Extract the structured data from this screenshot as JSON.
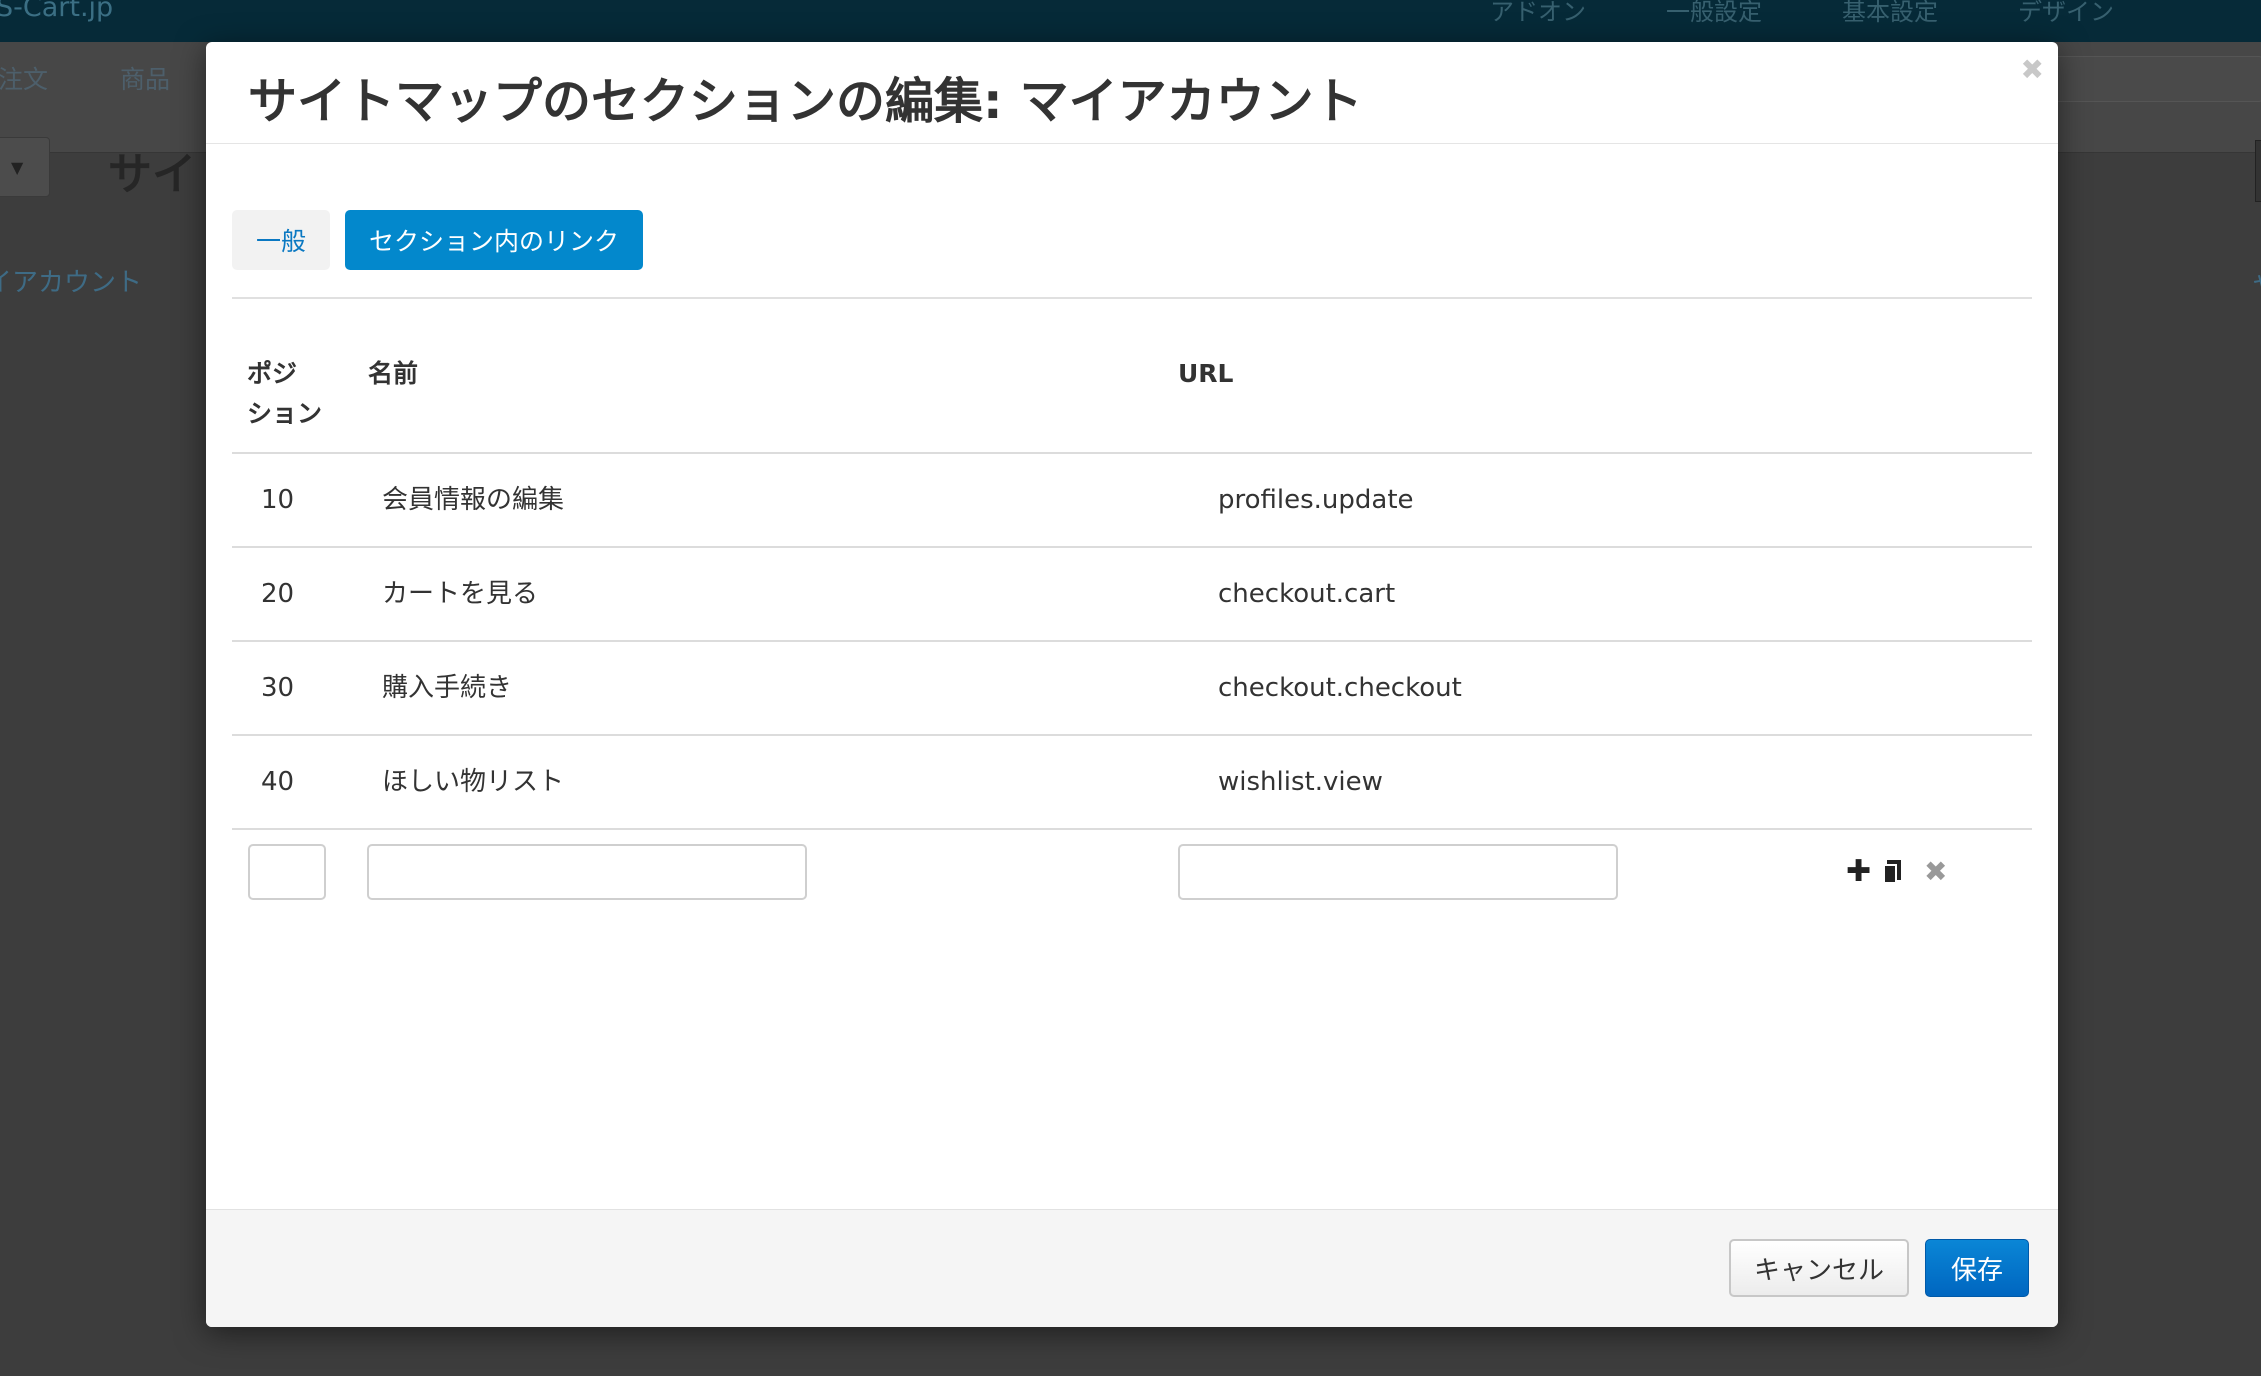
{
  "background": {
    "brand": "S-Cart.jp",
    "top_menu": [
      "アドオン",
      "一般設定",
      "基本設定",
      "デザイン"
    ],
    "main_menu": [
      "注文",
      "商品"
    ],
    "page_title": "サイ",
    "breadcrumb": "イアカウント",
    "right_link": "ャ"
  },
  "modal": {
    "title": "サイトマップのセクションの編集: マイアカウント",
    "tabs": [
      {
        "label": "一般",
        "active": false
      },
      {
        "label": "セクション内のリンク",
        "active": true
      }
    ],
    "table": {
      "headers": {
        "position_line1": "ポジ",
        "position_line2": "ション",
        "name": "名前",
        "url": "URL"
      },
      "rows": [
        {
          "position": "10",
          "name": "会員情報の編集",
          "url": "profiles.update"
        },
        {
          "position": "20",
          "name": "カートを見る",
          "url": "checkout.cart"
        },
        {
          "position": "30",
          "name": "購入手続き",
          "url": "checkout.checkout"
        },
        {
          "position": "40",
          "name": "ほしい物リスト",
          "url": "wishlist.view"
        }
      ],
      "new_row": {
        "position": "",
        "name": "",
        "url": ""
      }
    },
    "buttons": {
      "cancel": "キャンセル",
      "save": "保存"
    },
    "icons": [
      "close-icon",
      "plus-icon",
      "clone-icon",
      "remove-icon"
    ]
  },
  "colors": {
    "accent": "#0388cc",
    "save_button": "#0066c0",
    "overlay": "#3d3d3d"
  }
}
